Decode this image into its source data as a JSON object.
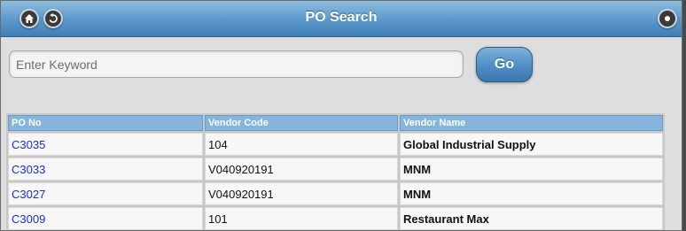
{
  "header": {
    "title": "PO Search"
  },
  "search": {
    "placeholder": "Enter Keyword",
    "value": "",
    "go_label": "Go"
  },
  "table": {
    "columns": [
      "PO No",
      "Vendor Code",
      "Vendor Name"
    ],
    "rows": [
      {
        "po": "C3035",
        "vendor_code": "104",
        "vendor_name": "Global Industrial Supply"
      },
      {
        "po": "C3033",
        "vendor_code": "V040920191",
        "vendor_name": "MNM"
      },
      {
        "po": "C3027",
        "vendor_code": "V040920191",
        "vendor_name": "MNM"
      },
      {
        "po": "C3009",
        "vendor_code": "101",
        "vendor_name": "Restaurant Max"
      }
    ]
  },
  "colors": {
    "header_bar": "#5e9bcc",
    "table_header": "#85b5dc",
    "po_link": "#1a2fcc",
    "go_button": "#4f8dc4"
  },
  "icons": {
    "home": "home-icon",
    "back": "back-arrow-icon",
    "right_edge": "partially-visible-icon"
  }
}
